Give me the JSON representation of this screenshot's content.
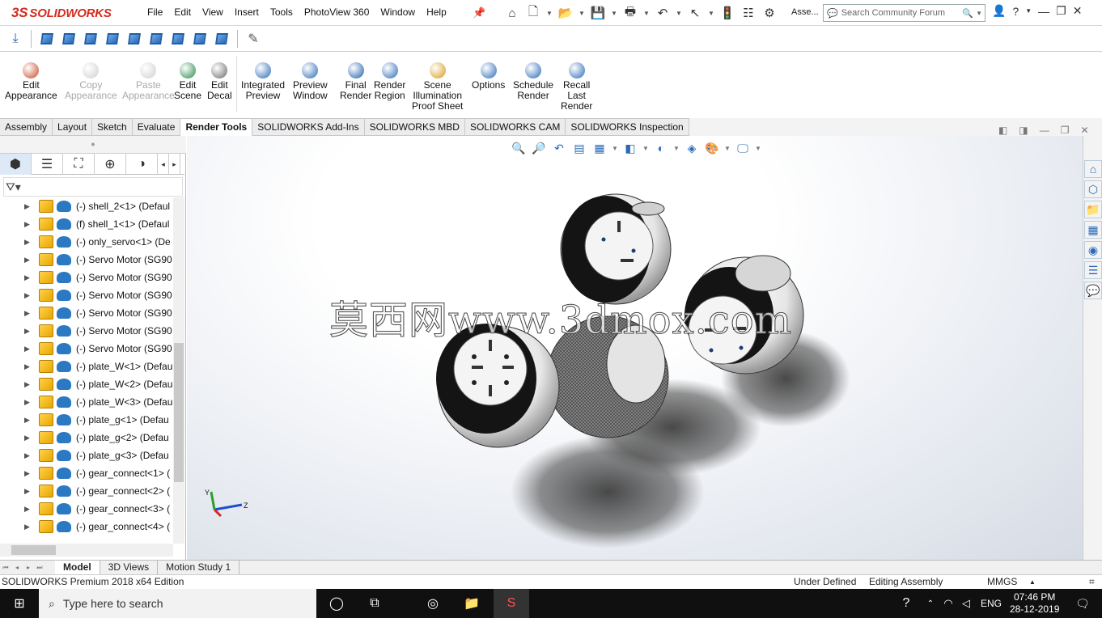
{
  "app": {
    "brand_ds": "3S",
    "brand_name": "SOLIDWORKS"
  },
  "menu": [
    "File",
    "Edit",
    "View",
    "Insert",
    "Tools",
    "PhotoView 360",
    "Window",
    "Help"
  ],
  "quick_icons": [
    "home-icon",
    "new-document-icon",
    "open-icon",
    "save-icon",
    "print-icon",
    "undo-icon",
    "select-arrow-icon",
    "rebuild-icon",
    "file-properties-icon",
    "options-icon"
  ],
  "assembly_short": "Asse...",
  "search": {
    "placeholder": "Search Community Forum"
  },
  "ribbon": [
    {
      "label1": "Edit",
      "label2": "Appearance",
      "label3": "",
      "disabled": false,
      "icon": "edit-appearance-icon",
      "color": "#c84a2a"
    },
    {
      "label1": "Copy",
      "label2": "Appearance",
      "label3": "",
      "disabled": true,
      "icon": "copy-appearance-icon",
      "color": "#d0d0d0"
    },
    {
      "label1": "Paste",
      "label2": "Appearance",
      "label3": "",
      "disabled": true,
      "icon": "paste-appearance-icon",
      "color": "#d0d0d0"
    },
    {
      "label1": "Edit",
      "label2": "Scene",
      "label3": "",
      "disabled": false,
      "icon": "edit-scene-icon",
      "color": "#2a8a4a"
    },
    {
      "label1": "Edit",
      "label2": "Decal",
      "label3": "",
      "disabled": false,
      "icon": "edit-decal-icon",
      "color": "#6a6a6a"
    },
    {
      "label1": "Integrated",
      "label2": "Preview",
      "label3": "",
      "disabled": false,
      "icon": "integrated-preview-icon",
      "color": "#2a6ab8"
    },
    {
      "label1": "Preview",
      "label2": "Window",
      "label3": "",
      "disabled": false,
      "icon": "preview-window-icon",
      "color": "#2a6ab8"
    },
    {
      "label1": "Final",
      "label2": "Render",
      "label3": "",
      "disabled": false,
      "icon": "final-render-icon",
      "color": "#1e5fa8"
    },
    {
      "label1": "Render",
      "label2": "Region",
      "label3": "",
      "disabled": false,
      "icon": "render-region-icon",
      "color": "#2a6ab8"
    },
    {
      "label1": "Scene",
      "label2": "Illumination",
      "label3": "Proof Sheet",
      "disabled": false,
      "icon": "scene-illumination-icon",
      "color": "#d69a1a"
    },
    {
      "label1": "Options",
      "label2": "",
      "label3": "",
      "disabled": false,
      "icon": "render-options-icon",
      "color": "#2a6ab8"
    },
    {
      "label1": "Schedule",
      "label2": "Render",
      "label3": "",
      "disabled": false,
      "icon": "schedule-render-icon",
      "color": "#2a6ab8"
    },
    {
      "label1": "Recall",
      "label2": "Last",
      "label3": "Render",
      "disabled": false,
      "icon": "recall-last-render-icon",
      "color": "#2a6ab8"
    }
  ],
  "tabs": [
    "Assembly",
    "Layout",
    "Sketch",
    "Evaluate",
    "Render Tools",
    "SOLIDWORKS Add-Ins",
    "SOLIDWORKS MBD",
    "SOLIDWORKS CAM",
    "SOLIDWORKS Inspection"
  ],
  "active_tab": "Render Tools",
  "tree": [
    "(-) shell_2<1> (Defaul",
    "(f) shell_1<1> (Defaul",
    "(-) only_servo<1> (De",
    "(-) Servo Motor (SG90",
    "(-) Servo Motor (SG90",
    "(-) Servo Motor (SG90",
    "(-) Servo Motor (SG90",
    "(-) Servo Motor (SG90",
    "(-) Servo Motor (SG90",
    "(-) plate_W<1> (Defau",
    "(-) plate_W<2> (Defau",
    "(-) plate_W<3> (Defau",
    "(-) plate_g<1> (Defau",
    "(-) plate_g<2> (Defau",
    "(-) plate_g<3> (Defau",
    "(-) gear_connect<1> (",
    "(-) gear_connect<2> (",
    "(-) gear_connect<3> (",
    "(-) gear_connect<4> ("
  ],
  "watermark": "莫西网www.3dmox.com",
  "bottom_tabs": [
    "Model",
    "3D Views",
    "Motion Study 1"
  ],
  "status": {
    "edition": "SOLIDWORKS Premium 2018 x64 Edition",
    "state": "Under Defined",
    "mode": "Editing Assembly",
    "units": "MMGS"
  },
  "taskbar": {
    "search_placeholder": "Type here to search",
    "lang": "ENG",
    "time": "07:46 PM",
    "date": "28-12-2019"
  }
}
